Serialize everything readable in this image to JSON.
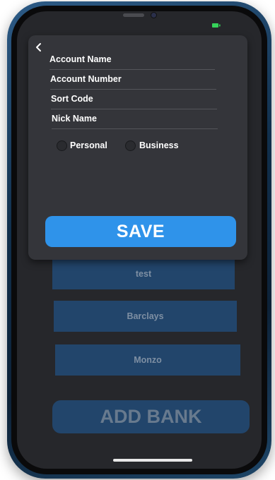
{
  "form": {
    "account_name_label": "Account Name",
    "account_number_label": "Account Number",
    "sort_code_label": "Sort Code",
    "nick_name_label": "Nick Name",
    "radio_options": [
      "Personal",
      "Business"
    ],
    "save_label": "SAVE"
  },
  "banks": {
    "items": [
      "test",
      "Barclays",
      "Monzo"
    ],
    "add_label": "ADD BANK"
  },
  "colors": {
    "accent": "#2f93ea",
    "bank_item_bg": "#22456b",
    "sheet_bg": "#34353a",
    "screen_bg": "#26272b",
    "battery": "#36d35a"
  },
  "icons": {
    "back": "chevron-left-icon",
    "battery": "battery-icon"
  }
}
